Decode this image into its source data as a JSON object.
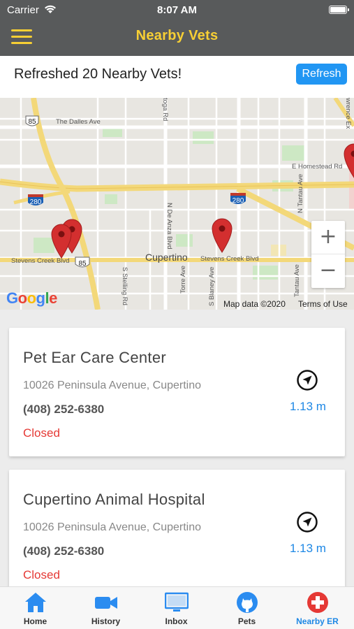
{
  "status_bar": {
    "carrier": "Carrier",
    "time": "8:07 AM"
  },
  "header": {
    "title": "Nearby Vets"
  },
  "refresh": {
    "message": "Refreshed 20 Nearby Vets!",
    "button_label": "Refresh"
  },
  "map": {
    "labels": {
      "route_85_top": "85",
      "the_dalles": "The Dalles Ave",
      "route_280_left": "280",
      "route_280_right": "280",
      "homestead": "E Homestead Rd",
      "de_anza": "N De Anza Blvd",
      "stevens_left": "Stevens Creek Blvd",
      "stevens_right": "Stevens Creek Blvd",
      "route_85_bottom": "85",
      "cupertino": "Cupertino",
      "stelling": "S Stelling Rd",
      "torre": "Torre Ave",
      "blaney": "S Blaney Ave",
      "tantau_n": "N Tantau Ave",
      "tantau": "Tantau Ave",
      "toga": "toga Rd",
      "lawrence": "wrence Ex"
    },
    "zoom_in": "+",
    "zoom_out": "−",
    "attribution": "Map data ©2020",
    "terms": "Terms of Use",
    "google": [
      "G",
      "o",
      "o",
      "g",
      "l",
      "e"
    ],
    "google_colors": [
      "#4285f4",
      "#ea4335",
      "#fbbc05",
      "#4285f4",
      "#34a853",
      "#ea4335"
    ]
  },
  "vets": [
    {
      "name": "Pet Ear Care Center",
      "address": "10026 Peninsula Avenue, Cupertino",
      "phone": "(408) 252-6380",
      "status": "Closed",
      "distance": "1.13 m"
    },
    {
      "name": "Cupertino Animal Hospital",
      "address": "10026 Peninsula Avenue, Cupertino",
      "phone": "(408) 252-6380",
      "status": "Closed",
      "distance": "1.13 m"
    }
  ],
  "tabs": [
    {
      "label": "Home",
      "icon": "home-icon"
    },
    {
      "label": "History",
      "icon": "video-camera-icon"
    },
    {
      "label": "Inbox",
      "icon": "monitor-icon"
    },
    {
      "label": "Pets",
      "icon": "github-icon"
    },
    {
      "label": "Nearby ER",
      "icon": "red-cross-icon"
    }
  ],
  "colors": {
    "header_bg": "#585a5b",
    "accent_yellow": "#f7cf34",
    "accent_blue": "#1e88e5",
    "closed_red": "#e53935",
    "marker_red": "#d32f2f"
  }
}
